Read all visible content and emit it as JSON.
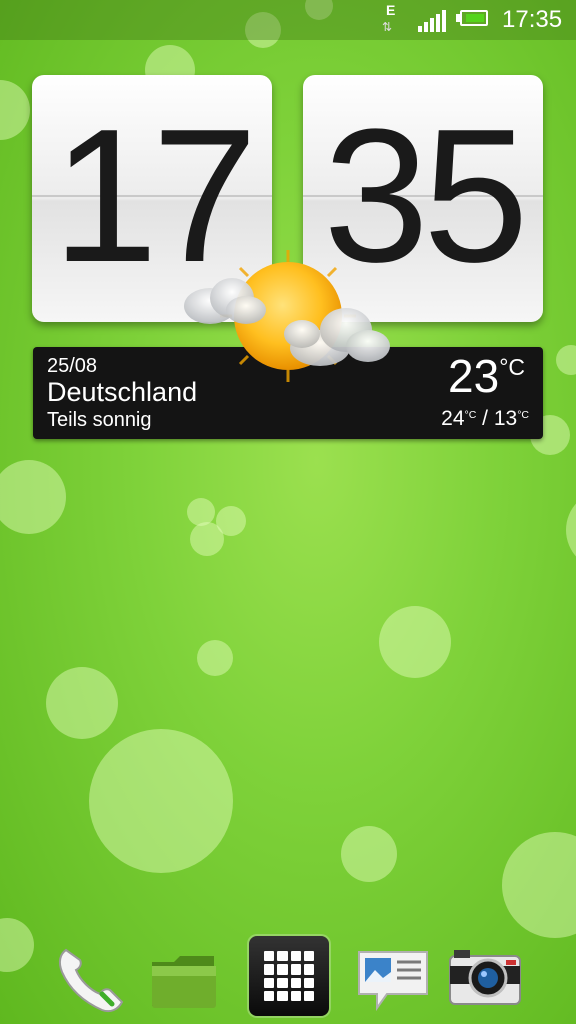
{
  "status_bar": {
    "network_type": "E",
    "time": "17:35",
    "icons": [
      "data-transfer-icon",
      "signal-icon",
      "battery-icon"
    ],
    "battery_level": 0.9
  },
  "clock": {
    "hours": "17",
    "minutes": "35"
  },
  "weather": {
    "date": "25/08",
    "location": "Deutschland",
    "condition": "Teils sonnig",
    "temperature": "23",
    "unit": "°C",
    "high": "24",
    "low": "13",
    "range_separator": " / ",
    "icon": "partly-sunny-icon"
  },
  "dock": {
    "items": [
      "phone-icon",
      "folder-icon",
      "all-apps-icon",
      "messages-icon",
      "camera-icon"
    ]
  },
  "colors": {
    "wallpaper": "#7fd23a",
    "weather_bg": "#141414",
    "battery": "#55d41c"
  }
}
